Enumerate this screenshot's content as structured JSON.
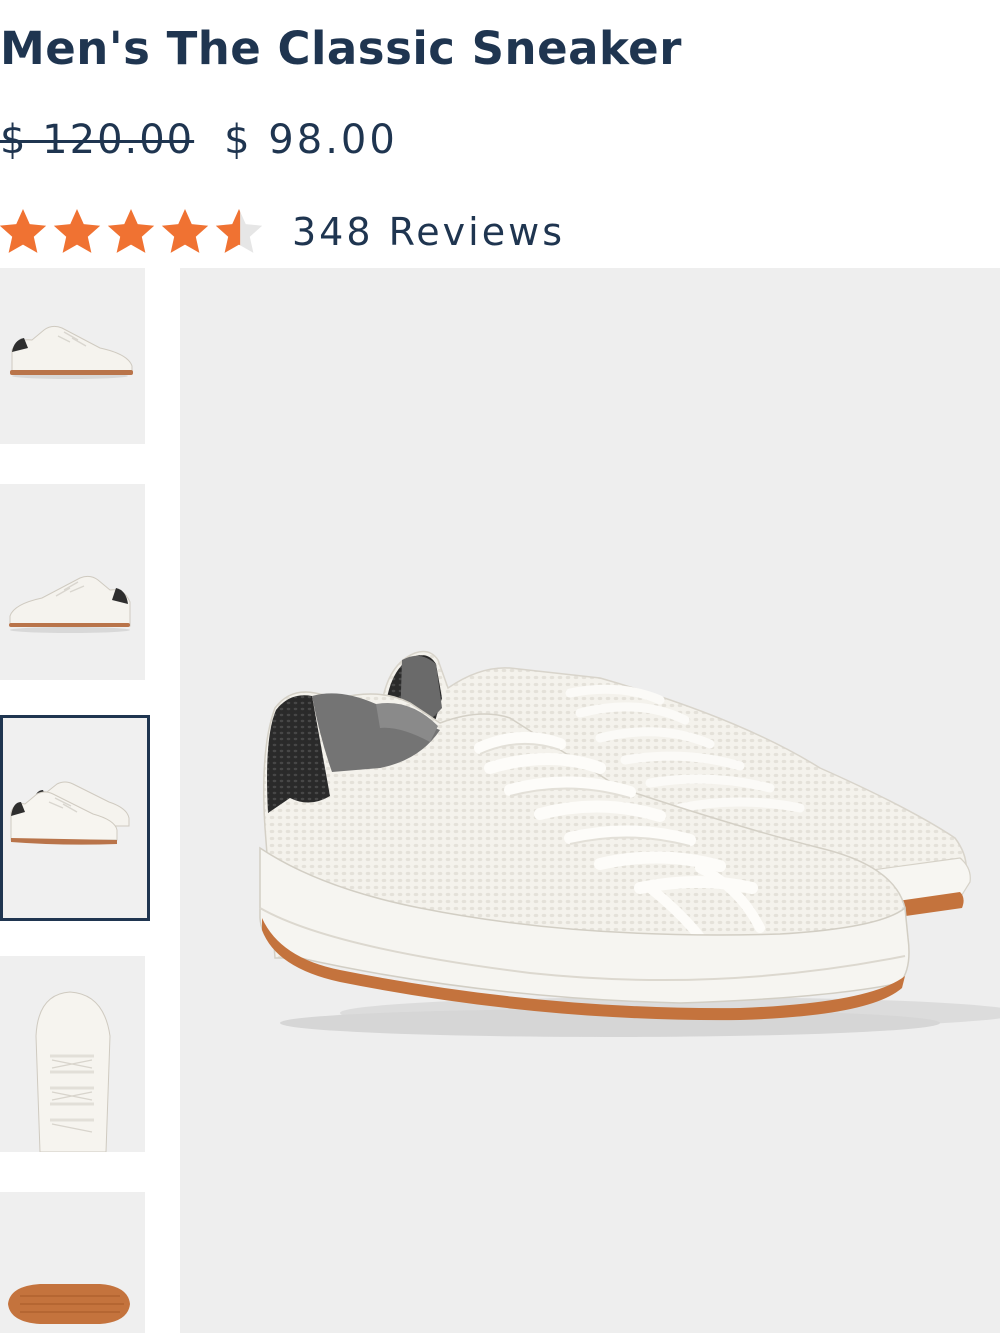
{
  "product": {
    "title": "Men's The Classic Sneaker",
    "price_original": "$ 120.00",
    "price_sale": "$ 98.00",
    "rating": 4.5,
    "rating_max": 5,
    "reviews_label": "348 Reviews"
  },
  "colors": {
    "star": "#f07232",
    "star_empty": "#e6e6e6",
    "text": "#1f3550",
    "image_bg": "#eeeeee"
  },
  "gallery": {
    "thumbnails": [
      {
        "view": "side-left"
      },
      {
        "view": "side-right"
      },
      {
        "view": "pair-angle",
        "selected": true
      },
      {
        "view": "top"
      },
      {
        "view": "sole"
      }
    ],
    "main_view": "pair-angle"
  }
}
